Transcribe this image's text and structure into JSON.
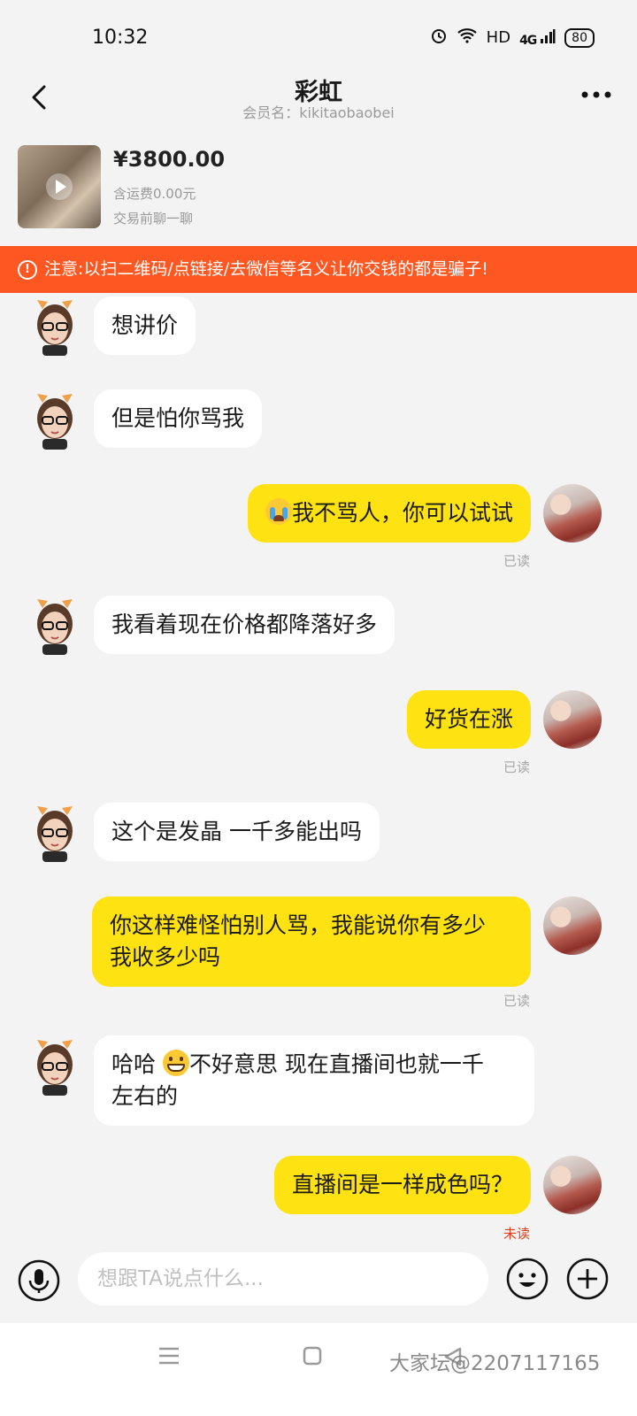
{
  "status_bar": {
    "time": "10:32",
    "network": "HD",
    "signal": "4G",
    "battery": "80"
  },
  "header": {
    "title": "彩虹",
    "subtitle": "会员名：kikitaobaobei"
  },
  "product": {
    "price": "¥3800.00",
    "shipping": "含运费0.00元",
    "note": "交易前聊一聊"
  },
  "warning": {
    "text": "注意:以扫二维码/点链接/去微信等名义让你交钱的都是骗子!"
  },
  "messages": [
    {
      "side": "in",
      "text": "想讲价"
    },
    {
      "side": "in",
      "text": "但是怕你骂我"
    },
    {
      "side": "out",
      "emoji": "crying-face",
      "text": "我不骂人，你可以试试",
      "status": "已读"
    },
    {
      "side": "in",
      "text": "我看着现在价格都降落好多"
    },
    {
      "side": "out",
      "text": "好货在涨",
      "status": "已读"
    },
    {
      "side": "in",
      "text": "这个是发晶 一千多能出吗"
    },
    {
      "side": "out",
      "line1": "你这样难怪怕别人骂，我能说你有多少",
      "line2": "我收多少吗",
      "status": "已读"
    },
    {
      "side": "in",
      "prefix": "哈哈 ",
      "emoji": "grinning-face",
      "line1": "不好意思 现在直播间也就一千",
      "line2": "左右的"
    },
    {
      "side": "out",
      "text": "直播间是一样成色吗？",
      "status": "未读"
    }
  ],
  "input": {
    "placeholder": "想跟TA说点什么..."
  },
  "watermark": "大家坛@2207117165",
  "colors": {
    "accent_yellow": "#ffe211",
    "warning_orange": "#ff5722",
    "unread_red": "#e53d16"
  }
}
